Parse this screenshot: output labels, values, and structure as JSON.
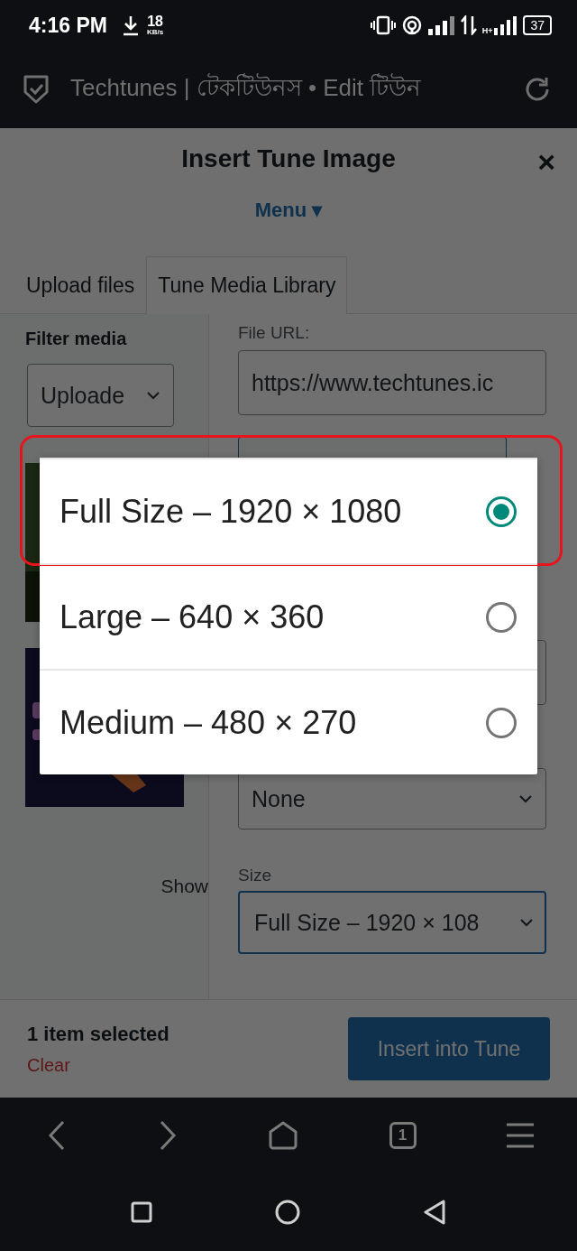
{
  "status_bar": {
    "time": "4:16 PM",
    "speed": "18",
    "speed_unit": "KB/s",
    "network_type": "H+",
    "battery": "37"
  },
  "browser": {
    "title": "Techtunes | টেকটিউনস • Edit টিউন",
    "tab_count": "1"
  },
  "modal": {
    "title": "Insert Tune Image",
    "close": "×",
    "menu_link": "Menu ▾",
    "tabs": [
      {
        "label": "Upload files",
        "selected": false
      },
      {
        "label": "Tune Media Library",
        "selected": true
      }
    ],
    "filter_label": "Filter media",
    "filter_select": "Uploade",
    "show_label": "Show",
    "file_url_label": "File URL:",
    "file_url_value": "https://www.techtunes.ic",
    "link_select": "None",
    "size_label": "Size",
    "size_select": "Full Size – 1920 × 108",
    "selection_count": "1 item selected",
    "clear_link": "Clear",
    "insert_button": "Insert into Tune"
  },
  "size_popup": {
    "options": [
      {
        "label": "Full Size – 1920 × 1080",
        "selected": true,
        "highlighted": true
      },
      {
        "label": "Large – 640 × 360",
        "selected": false,
        "highlighted": false
      },
      {
        "label": "Medium – 480 × 270",
        "selected": false,
        "highlighted": false
      }
    ]
  }
}
